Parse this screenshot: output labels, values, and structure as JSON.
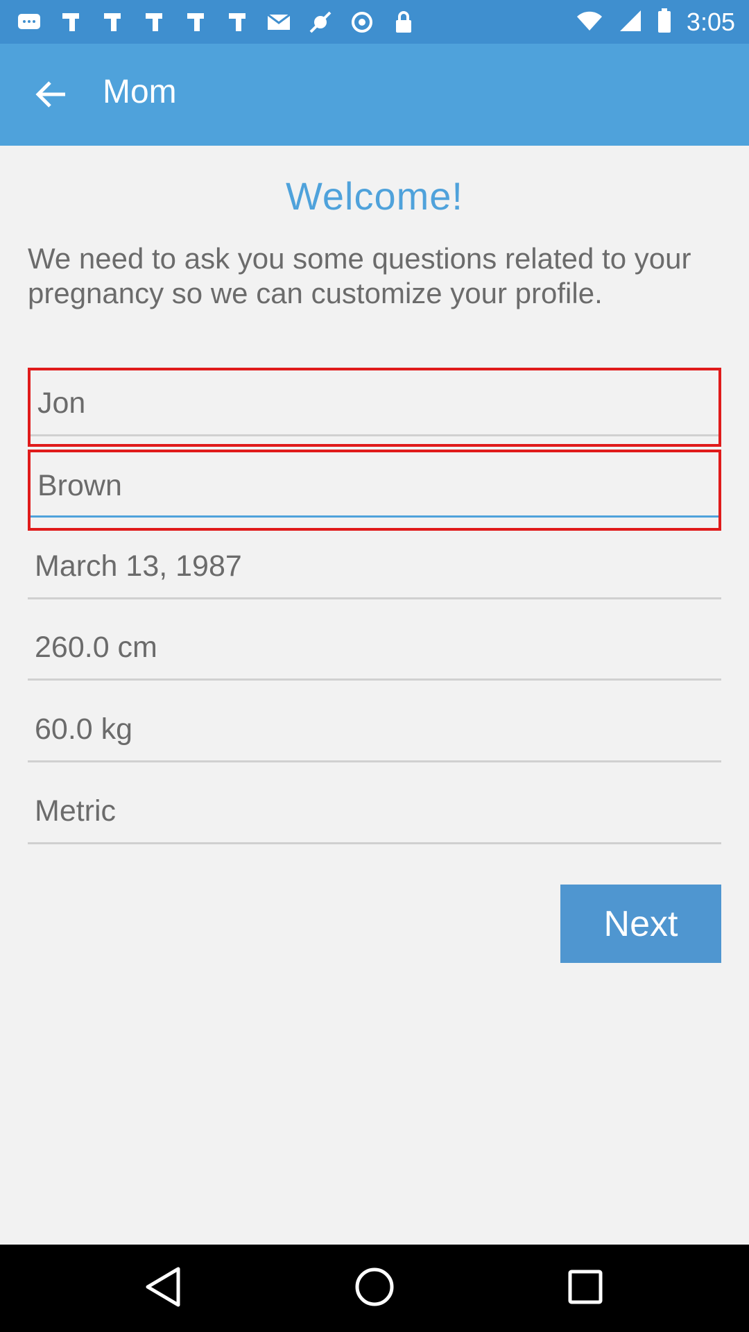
{
  "status_bar": {
    "time": "3:05",
    "icons": [
      "message-icon",
      "app-icon",
      "app-icon",
      "app-icon",
      "app-icon",
      "app-icon",
      "email-icon",
      "fake-gps-icon",
      "settings-icon",
      "lock-icon"
    ],
    "right_icons": [
      "wifi-icon",
      "signal-icon",
      "battery-icon"
    ]
  },
  "app_bar": {
    "title": "Mom",
    "back_icon": "arrow-back-icon"
  },
  "welcome": "Welcome!",
  "intro": "We need to ask you some questions related to your pregnancy so we can customize your profile.",
  "form": {
    "first_name": "Jon",
    "last_name": "Brown",
    "birth_date": "March 13, 1987",
    "height": "260.0 cm",
    "weight": "60.0 kg",
    "units": "Metric"
  },
  "next_label": "Next",
  "nav_bar": {
    "back_icon": "nav-back-icon",
    "home_icon": "nav-home-icon",
    "recents_icon": "nav-recents-icon"
  },
  "colors": {
    "app_bar": "#4fa2db",
    "accent": "#4fa2db",
    "highlight": "#e01b1b"
  }
}
